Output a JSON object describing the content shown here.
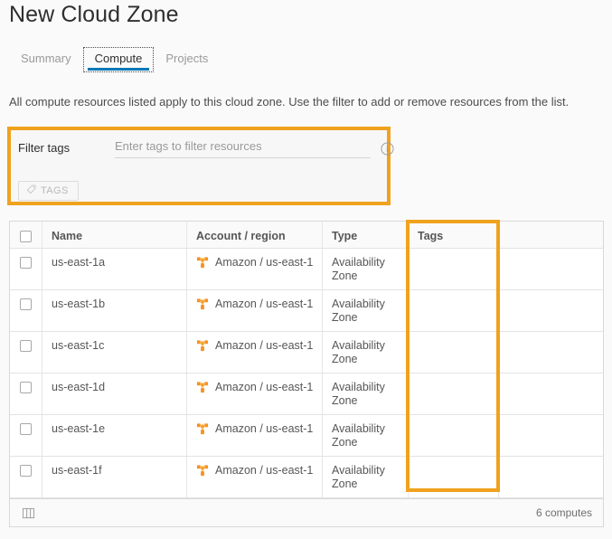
{
  "header": {
    "title": "New Cloud Zone"
  },
  "tabs": [
    {
      "label": "Summary",
      "active": false
    },
    {
      "label": "Compute",
      "active": true
    },
    {
      "label": "Projects",
      "active": false
    }
  ],
  "description": "All compute resources listed apply to this cloud zone. Use the filter to add or remove resources from the list.",
  "filter": {
    "label": "Filter tags",
    "input_value": "",
    "placeholder": "Enter tags to filter resources",
    "info_icon": "info-circle-icon",
    "tags_button": {
      "label": "TAGS",
      "icon": "tag-icon",
      "disabled": true
    },
    "highlight_color": "#f0a21e"
  },
  "grid": {
    "columns": [
      {
        "key": "checkbox",
        "label": ""
      },
      {
        "key": "name",
        "label": "Name"
      },
      {
        "key": "account",
        "label": "Account / region"
      },
      {
        "key": "type",
        "label": "Type"
      },
      {
        "key": "tags",
        "label": "Tags"
      },
      {
        "key": "blank",
        "label": ""
      }
    ],
    "rows": [
      {
        "selected": false,
        "name": "us-east-1a",
        "account_icon": "aws-icon",
        "account": "Amazon / us-east-1",
        "type": "Availability Zone",
        "tags": ""
      },
      {
        "selected": false,
        "name": "us-east-1b",
        "account_icon": "aws-icon",
        "account": "Amazon / us-east-1",
        "type": "Availability Zone",
        "tags": ""
      },
      {
        "selected": false,
        "name": "us-east-1c",
        "account_icon": "aws-icon",
        "account": "Amazon / us-east-1",
        "type": "Availability Zone",
        "tags": ""
      },
      {
        "selected": false,
        "name": "us-east-1d",
        "account_icon": "aws-icon",
        "account": "Amazon / us-east-1",
        "type": "Availability Zone",
        "tags": ""
      },
      {
        "selected": false,
        "name": "us-east-1e",
        "account_icon": "aws-icon",
        "account": "Amazon / us-east-1",
        "type": "Availability Zone",
        "tags": ""
      },
      {
        "selected": false,
        "name": "us-east-1f",
        "account_icon": "aws-icon",
        "account": "Amazon / us-east-1",
        "type": "Availability Zone",
        "tags": ""
      }
    ],
    "footer": {
      "column_picker_icon": "column-toggle-icon",
      "count_label": "6 computes"
    },
    "tags_column_highlight_color": "#f0a21e"
  },
  "colors": {
    "accent_blue": "#0079b8",
    "highlight_orange": "#f0a21e",
    "aws_orange": "#f79122",
    "page_background": "#fafafa",
    "grid_background": "#ffffff"
  }
}
